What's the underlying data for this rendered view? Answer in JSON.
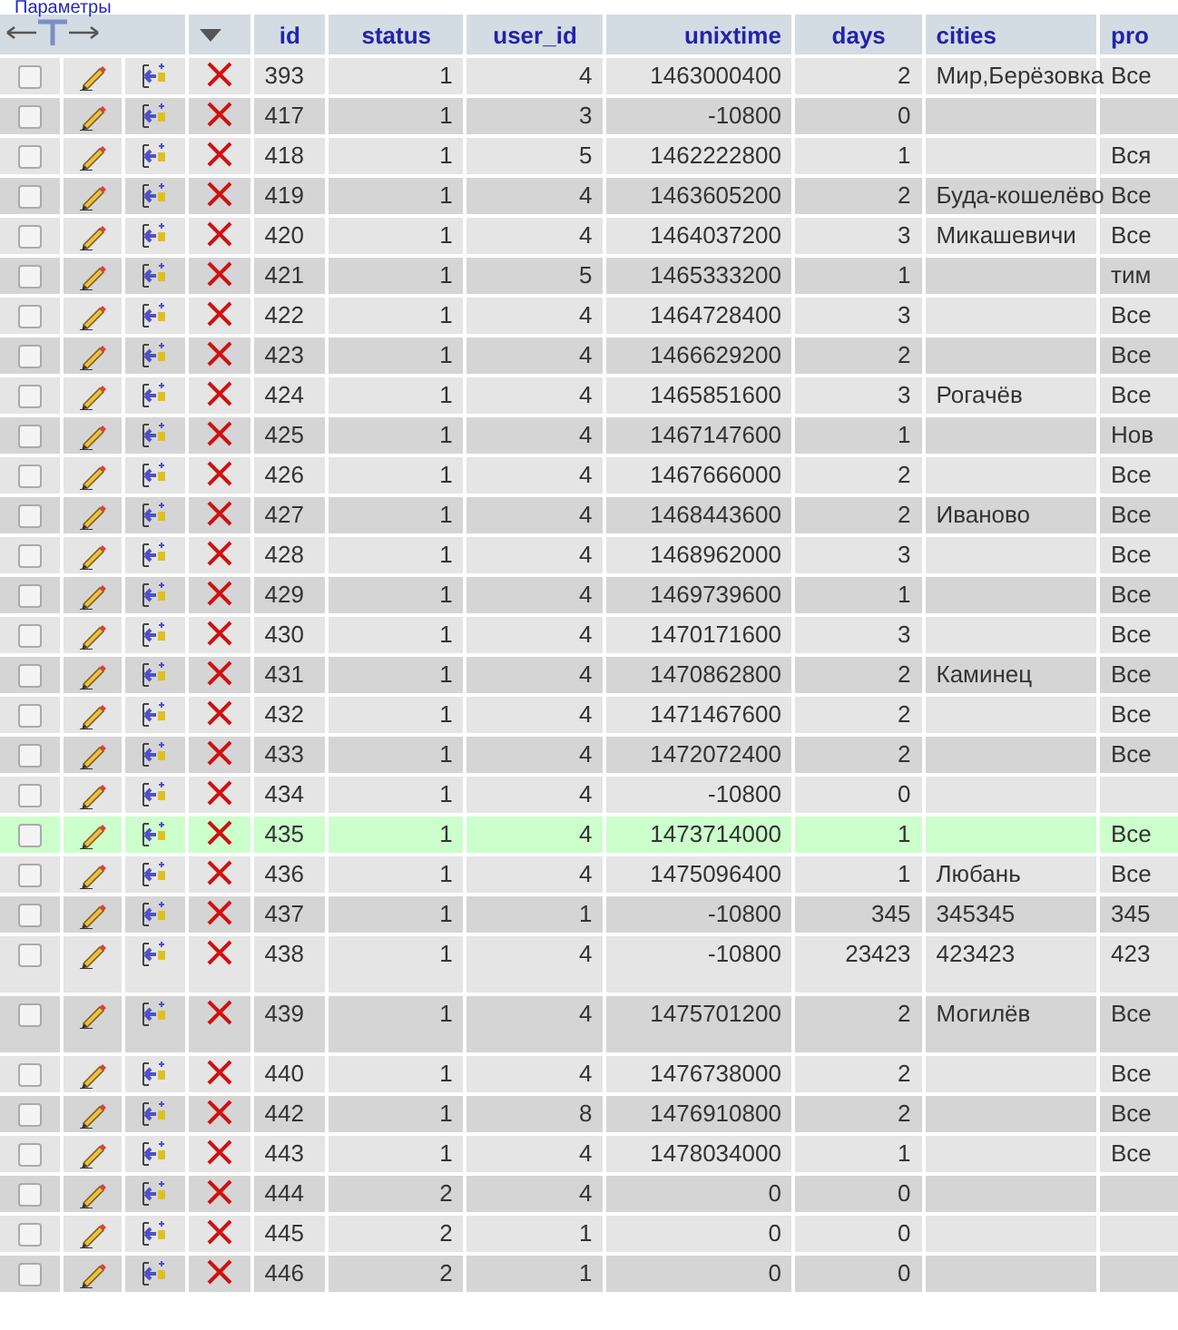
{
  "top_link": "Параметры",
  "columns": [
    "id",
    "status",
    "user_id",
    "unixtime",
    "days",
    "cities",
    "pro"
  ],
  "rows": [
    {
      "id": "393",
      "status": "1",
      "user_id": "4",
      "unixtime": "1463000400",
      "days": "2",
      "cities": "Мир,Берёзовка",
      "pro": "Все",
      "checked": false,
      "highlighted": false,
      "tall": false
    },
    {
      "id": "417",
      "status": "1",
      "user_id": "3",
      "unixtime": "-10800",
      "days": "0",
      "cities": "",
      "pro": "",
      "checked": false,
      "highlighted": false,
      "tall": false
    },
    {
      "id": "418",
      "status": "1",
      "user_id": "5",
      "unixtime": "1462222800",
      "days": "1",
      "cities": "",
      "pro": "Вся",
      "checked": false,
      "highlighted": false,
      "tall": false
    },
    {
      "id": "419",
      "status": "1",
      "user_id": "4",
      "unixtime": "1463605200",
      "days": "2",
      "cities": "Буда-кошелёво",
      "pro": "Все",
      "checked": false,
      "highlighted": false,
      "tall": false
    },
    {
      "id": "420",
      "status": "1",
      "user_id": "4",
      "unixtime": "1464037200",
      "days": "3",
      "cities": "Микашевичи",
      "pro": "Все",
      "checked": false,
      "highlighted": false,
      "tall": false
    },
    {
      "id": "421",
      "status": "1",
      "user_id": "5",
      "unixtime": "1465333200",
      "days": "1",
      "cities": "",
      "pro": "тим",
      "checked": false,
      "highlighted": false,
      "tall": false
    },
    {
      "id": "422",
      "status": "1",
      "user_id": "4",
      "unixtime": "1464728400",
      "days": "3",
      "cities": "",
      "pro": "Все",
      "checked": false,
      "highlighted": false,
      "tall": false
    },
    {
      "id": "423",
      "status": "1",
      "user_id": "4",
      "unixtime": "1466629200",
      "days": "2",
      "cities": "",
      "pro": "Все",
      "checked": false,
      "highlighted": false,
      "tall": false
    },
    {
      "id": "424",
      "status": "1",
      "user_id": "4",
      "unixtime": "1465851600",
      "days": "3",
      "cities": "Рогачёв",
      "pro": "Все",
      "checked": false,
      "highlighted": false,
      "tall": false
    },
    {
      "id": "425",
      "status": "1",
      "user_id": "4",
      "unixtime": "1467147600",
      "days": "1",
      "cities": "",
      "pro": "Нов",
      "checked": false,
      "highlighted": false,
      "tall": false
    },
    {
      "id": "426",
      "status": "1",
      "user_id": "4",
      "unixtime": "1467666000",
      "days": "2",
      "cities": "",
      "pro": "Все",
      "checked": false,
      "highlighted": false,
      "tall": false
    },
    {
      "id": "427",
      "status": "1",
      "user_id": "4",
      "unixtime": "1468443600",
      "days": "2",
      "cities": "Иваново",
      "pro": "Все",
      "checked": false,
      "highlighted": false,
      "tall": false
    },
    {
      "id": "428",
      "status": "1",
      "user_id": "4",
      "unixtime": "1468962000",
      "days": "3",
      "cities": "",
      "pro": "Все",
      "checked": false,
      "highlighted": false,
      "tall": false
    },
    {
      "id": "429",
      "status": "1",
      "user_id": "4",
      "unixtime": "1469739600",
      "days": "1",
      "cities": "",
      "pro": "Все",
      "checked": false,
      "highlighted": false,
      "tall": false
    },
    {
      "id": "430",
      "status": "1",
      "user_id": "4",
      "unixtime": "1470171600",
      "days": "3",
      "cities": "",
      "pro": "Все",
      "checked": false,
      "highlighted": false,
      "tall": false
    },
    {
      "id": "431",
      "status": "1",
      "user_id": "4",
      "unixtime": "1470862800",
      "days": "2",
      "cities": "Каминец",
      "pro": "Все",
      "checked": false,
      "highlighted": false,
      "tall": false
    },
    {
      "id": "432",
      "status": "1",
      "user_id": "4",
      "unixtime": "1471467600",
      "days": "2",
      "cities": "",
      "pro": "Все",
      "checked": false,
      "highlighted": false,
      "tall": false
    },
    {
      "id": "433",
      "status": "1",
      "user_id": "4",
      "unixtime": "1472072400",
      "days": "2",
      "cities": "",
      "pro": "Все",
      "checked": false,
      "highlighted": false,
      "tall": false
    },
    {
      "id": "434",
      "status": "1",
      "user_id": "4",
      "unixtime": "-10800",
      "days": "0",
      "cities": "",
      "pro": "",
      "checked": false,
      "highlighted": false,
      "tall": false
    },
    {
      "id": "435",
      "status": "1",
      "user_id": "4",
      "unixtime": "1473714000",
      "days": "1",
      "cities": "",
      "pro": "Все",
      "checked": false,
      "highlighted": true,
      "tall": false
    },
    {
      "id": "436",
      "status": "1",
      "user_id": "4",
      "unixtime": "1475096400",
      "days": "1",
      "cities": "Любань",
      "pro": "Все",
      "checked": false,
      "highlighted": false,
      "tall": false
    },
    {
      "id": "437",
      "status": "1",
      "user_id": "1",
      "unixtime": "-10800",
      "days": "345",
      "cities": "345345",
      "pro": "345",
      "checked": false,
      "highlighted": false,
      "tall": false
    },
    {
      "id": "438",
      "status": "1",
      "user_id": "4",
      "unixtime": "-10800",
      "days": "23423",
      "cities": "423423",
      "pro": "423",
      "checked": false,
      "highlighted": false,
      "tall": true
    },
    {
      "id": "439",
      "status": "1",
      "user_id": "4",
      "unixtime": "1475701200",
      "days": "2",
      "cities": "Могилёв",
      "pro": "Все",
      "checked": false,
      "highlighted": false,
      "tall": true
    },
    {
      "id": "440",
      "status": "1",
      "user_id": "4",
      "unixtime": "1476738000",
      "days": "2",
      "cities": "",
      "pro": "Все",
      "checked": false,
      "highlighted": false,
      "tall": false
    },
    {
      "id": "442",
      "status": "1",
      "user_id": "8",
      "unixtime": "1476910800",
      "days": "2",
      "cities": "",
      "pro": "Все",
      "checked": false,
      "highlighted": false,
      "tall": false
    },
    {
      "id": "443",
      "status": "1",
      "user_id": "4",
      "unixtime": "1478034000",
      "days": "1",
      "cities": "",
      "pro": "Все",
      "checked": false,
      "highlighted": false,
      "tall": false
    },
    {
      "id": "444",
      "status": "2",
      "user_id": "4",
      "unixtime": "0",
      "days": "0",
      "cities": "",
      "pro": "",
      "checked": false,
      "highlighted": false,
      "tall": false
    },
    {
      "id": "445",
      "status": "2",
      "user_id": "1",
      "unixtime": "0",
      "days": "0",
      "cities": "",
      "pro": "",
      "checked": false,
      "highlighted": false,
      "tall": false
    },
    {
      "id": "446",
      "status": "2",
      "user_id": "1",
      "unixtime": "0",
      "days": "0",
      "cities": "",
      "pro": "",
      "checked": false,
      "highlighted": false,
      "tall": false
    }
  ]
}
